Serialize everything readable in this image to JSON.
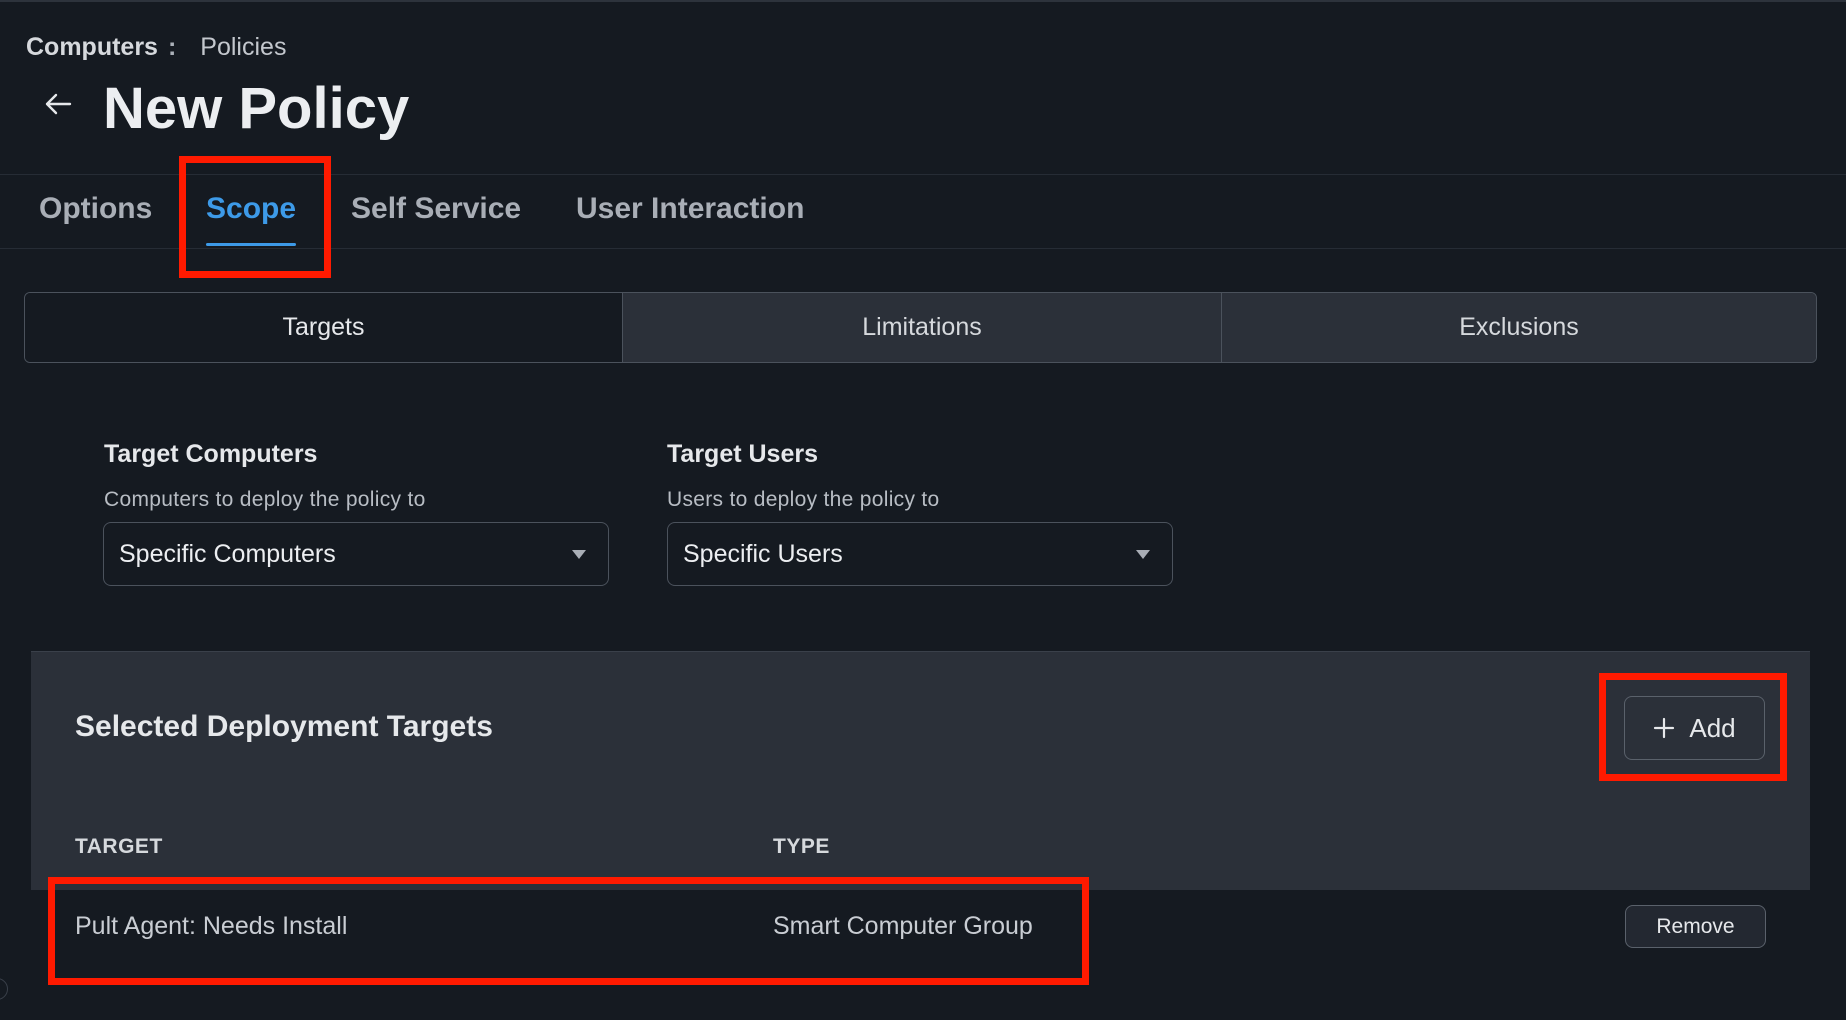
{
  "breadcrumb": {
    "parent": "Computers",
    "separator": ":",
    "current": "Policies"
  },
  "page": {
    "title": "New Policy"
  },
  "tabs": [
    {
      "label": "Options"
    },
    {
      "label": "Scope",
      "active": true
    },
    {
      "label": "Self Service"
    },
    {
      "label": "User Interaction"
    }
  ],
  "scope_tabs": [
    {
      "label": "Targets",
      "active": true
    },
    {
      "label": "Limitations"
    },
    {
      "label": "Exclusions"
    }
  ],
  "target_computers": {
    "label": "Target Computers",
    "help": "Computers to deploy the policy to",
    "value": "Specific Computers"
  },
  "target_users": {
    "label": "Target Users",
    "help": "Users to deploy the policy to",
    "value": "Specific Users"
  },
  "deployment_targets": {
    "title": "Selected Deployment Targets",
    "add_label": "Add",
    "columns": {
      "target": "TARGET",
      "type": "TYPE"
    },
    "rows": [
      {
        "target": "Pult Agent: Needs Install",
        "type": "Smart Computer Group",
        "action": "Remove"
      }
    ]
  },
  "icons": {
    "back": "arrow-left-icon",
    "add": "plus-icon",
    "dropdown": "caret-down-icon"
  },
  "colors": {
    "accent": "#3d9ae8",
    "highlight": "#ff1a00",
    "background": "#151a21",
    "panel": "#2b3039"
  }
}
